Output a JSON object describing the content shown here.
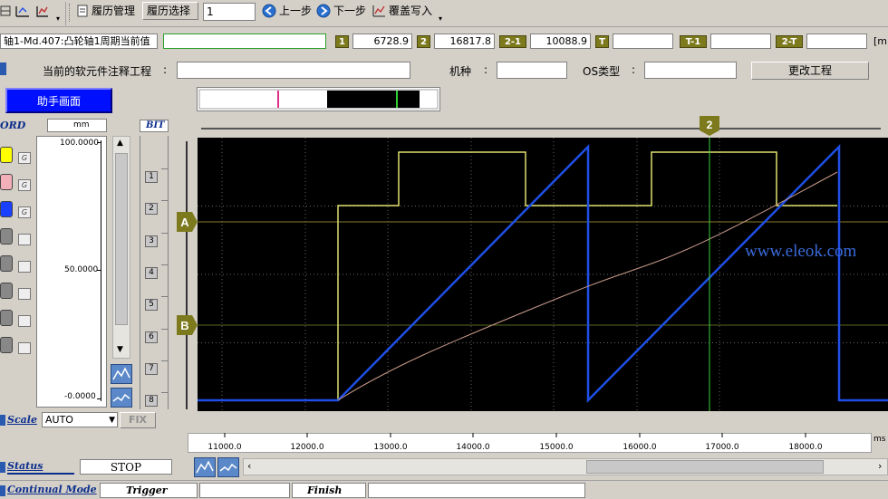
{
  "toolbar": {
    "history_manage": "履历管理",
    "history_select": "履历选择",
    "history_index": "1",
    "prev_step": "上一步",
    "next_step": "下一步",
    "overwrite": "覆盖写入"
  },
  "cursor_row": {
    "signal_name": "轴1-Md.407:凸轮轴1周期当前值",
    "label_1": "1",
    "value_1": "6728.9",
    "label_2": "2",
    "value_2": "16817.8",
    "label_2_1": "2-1",
    "value_2_1": "10088.9",
    "label_t": "T",
    "value_t": "",
    "label_t_1": "T-1",
    "value_t_1": "",
    "label_2_t": "2-T",
    "value_2_t": "",
    "unit_partial": "[m"
  },
  "project_row": {
    "label": "当前的软元件注释工程",
    "colon1": ":",
    "value": "",
    "model_label": "机种",
    "colon2": ":",
    "model_value": "",
    "os_label": "OS类型",
    "colon3": ":",
    "os_value": "",
    "change_btn": "更改工程"
  },
  "left_panel": {
    "helper_screen": "助手画面",
    "word_label": "ORD",
    "unit": "mm",
    "scale_top": "100.0000",
    "scale_mid": "50.0000",
    "scale_bot": "-0.0000",
    "bit_label": "BIT",
    "bit_numbers": [
      "1",
      "2",
      "3",
      "4",
      "5",
      "6",
      "7",
      "8"
    ],
    "g_label": "G",
    "scale_label": "Scale",
    "scale_value": "AUTO",
    "fix_btn": "FIX"
  },
  "chart": {
    "cursor_2_label": "2",
    "marker_a": "A",
    "marker_b": "B",
    "watermark": "www.eleok.com",
    "x_unit": "ms",
    "x_ticks": [
      "11000.0",
      "12000.0",
      "13000.0",
      "14000.0",
      "15000.0",
      "16000.0",
      "17000.0",
      "18000.0"
    ]
  },
  "status": {
    "status_label": "Status",
    "status_value": "STOP",
    "mode_label": "Continual Mode",
    "trigger": "Trigger",
    "finish": "Finish"
  },
  "colors": {
    "panel": "#d4d0c8",
    "plot_bg": "#000000",
    "ramp": "#1f4fe6",
    "square": "#e0e070",
    "curve": "#c89a8a",
    "cursor": "#3fcf3f",
    "marker": "#7d7a1e",
    "helper_btn": "#0010ff"
  }
}
